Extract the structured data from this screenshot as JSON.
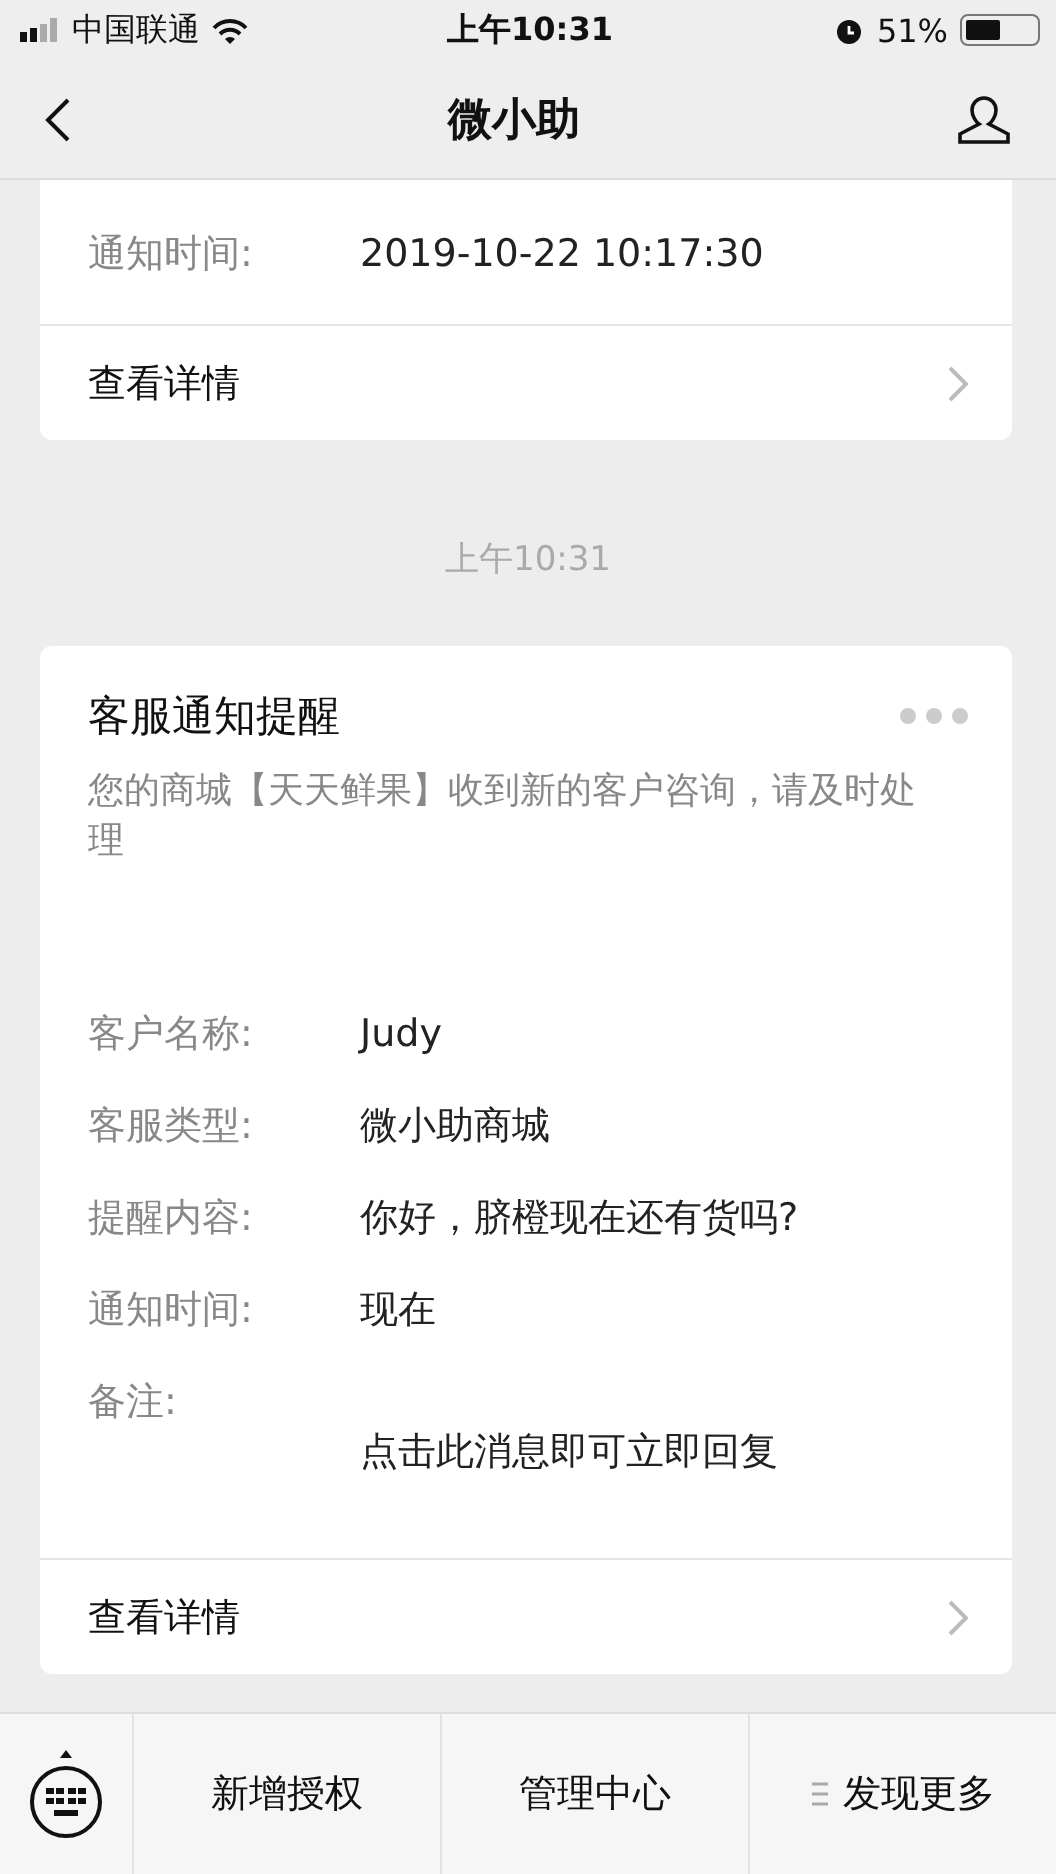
{
  "status_bar": {
    "carrier": "中国联通",
    "time": "上午10:31",
    "battery": {
      "text": "51%",
      "level": 0.51
    }
  },
  "nav": {
    "title": "微小助"
  },
  "messages": [
    {
      "kind": "card",
      "rows": [
        {
          "kind": "inline",
          "label": "通知时间:",
          "value": "2019-10-22 10:17:30"
        }
      ],
      "link": "查看详情"
    },
    {
      "kind": "time",
      "text": "上午10:31"
    },
    {
      "kind": "card",
      "title": "客服通知提醒",
      "description": "您的商城【天天鲜果】收到新的客户咨询，请及时处理",
      "rows": [
        {
          "kind": "inline",
          "label": "客户名称:",
          "value": "Judy"
        },
        {
          "kind": "inline",
          "label": "客服类型:",
          "value": "微小助商城"
        },
        {
          "kind": "inline",
          "label": "提醒内容:",
          "value": "你好，脐橙现在还有货吗?"
        },
        {
          "kind": "inline",
          "label": "通知时间:",
          "value": "现在"
        },
        {
          "kind": "below",
          "label": "备注:",
          "value": "点击此消息即可立即回复"
        }
      ],
      "link": "查看详情"
    }
  ],
  "menu": {
    "items": [
      {
        "label": "新增授权",
        "has_icon": false
      },
      {
        "label": "管理中心",
        "has_icon": false
      },
      {
        "label": "发现更多",
        "has_icon": true
      }
    ]
  }
}
